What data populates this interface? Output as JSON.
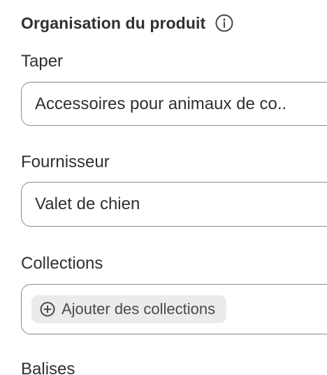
{
  "section": {
    "title": "Organisation du produit",
    "info_icon": "info-circle-icon"
  },
  "fields": {
    "type": {
      "label": "Taper",
      "value": "Accessoires pour animaux de co.."
    },
    "vendor": {
      "label": "Fournisseur",
      "value": "Valet de chien"
    },
    "collections": {
      "label": "Collections",
      "add_label": "Ajouter des collections",
      "add_icon": "plus-circle-icon"
    },
    "tags": {
      "label": "Balises"
    }
  }
}
